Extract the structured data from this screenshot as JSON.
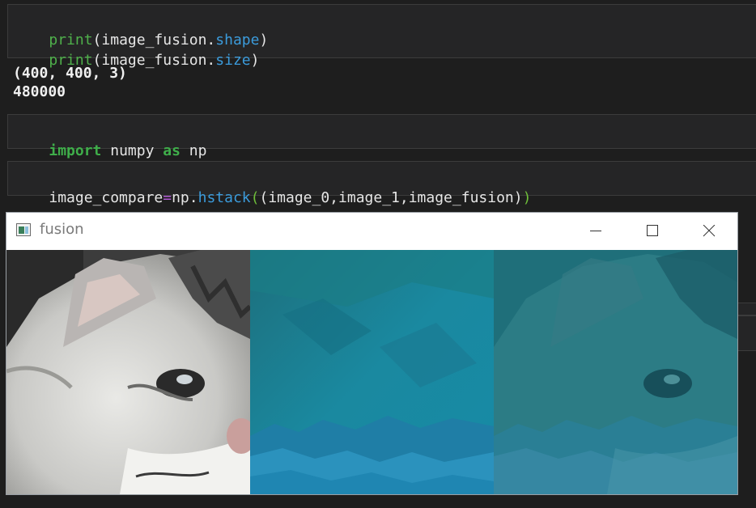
{
  "cells": {
    "cell1": {
      "line1": {
        "fn": "print",
        "open": "(",
        "obj": "image_fusion.",
        "attr": "shape",
        "close": ")"
      },
      "line2": {
        "fn": "print",
        "open": "(",
        "obj": "image_fusion.",
        "attr": "size",
        "close": ")"
      }
    },
    "output1": {
      "line1": "(400, 400, 3)",
      "line2": "480000"
    },
    "cell2": {
      "kw_import": "import",
      "module": "numpy",
      "kw_as": "as",
      "alias": "np"
    },
    "cell3": {
      "var": "image_compare",
      "op": "=",
      "obj": "np.",
      "fn": "hstack",
      "open": "(",
      "args": "(image_0,image_1,image_fusion)",
      "close": ")"
    }
  },
  "window": {
    "title": "fusion",
    "panels": [
      {
        "name": "image_0",
        "depicts": "cat"
      },
      {
        "name": "image_1",
        "depicts": "teal underwater texture"
      },
      {
        "name": "image_fusion",
        "depicts": "cat blended with teal texture"
      }
    ]
  },
  "icons": {
    "app": "app-window-icon",
    "minimize": "minimize-icon",
    "maximize": "maximize-icon",
    "close": "close-icon"
  },
  "colors": {
    "background": "#1e1e1e",
    "cell": "#252526",
    "function": "#4fb04b",
    "attribute": "#3b9bdb",
    "keyword": "#3fae4a",
    "operator": "#b35bd6"
  }
}
